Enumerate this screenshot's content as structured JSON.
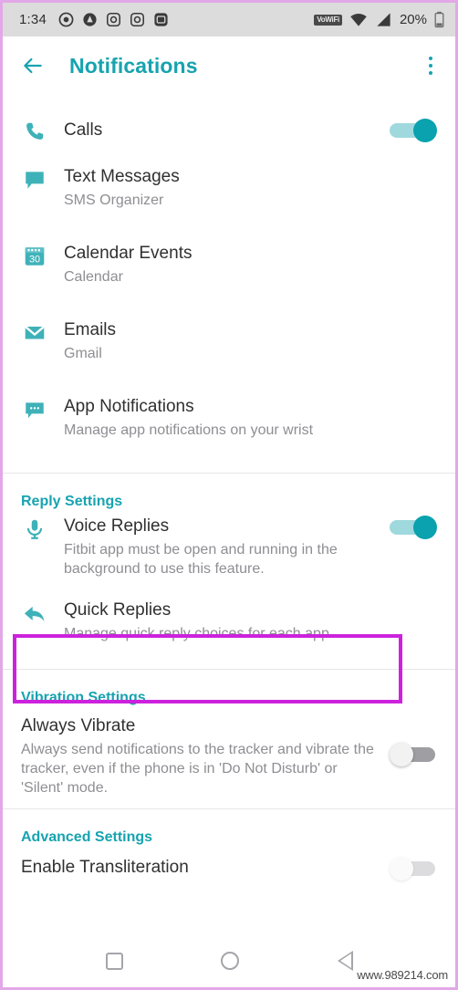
{
  "statusbar": {
    "time": "1:34",
    "left_icons": [
      "record-icon",
      "app-a-icon",
      "instagram-icon",
      "instagram-icon-2",
      "screenshot-icon"
    ],
    "vowifi_label": "VoWiFi",
    "wifi_icon": "wifi-icon",
    "signal_icon": "cellular-signal-icon",
    "battery_percent": "20%",
    "battery_icon": "battery-icon"
  },
  "appbar": {
    "back_icon": "back-arrow-icon",
    "title": "Notifications",
    "overflow_icon": "overflow-menu-icon"
  },
  "list": {
    "items": [
      {
        "name": "calls",
        "icon": "phone-icon",
        "title": "Calls",
        "subtitle": "",
        "toggle": "on"
      },
      {
        "name": "text-messages",
        "icon": "message-bubble-icon",
        "title": "Text Messages",
        "subtitle": "SMS Organizer",
        "toggle": "none"
      },
      {
        "name": "calendar-events",
        "icon": "calendar-icon",
        "icon_day": "30",
        "title": "Calendar Events",
        "subtitle": "Calendar",
        "toggle": "none"
      },
      {
        "name": "emails",
        "icon": "envelope-icon",
        "title": "Emails",
        "subtitle": "Gmail",
        "toggle": "none"
      },
      {
        "name": "app-notifications",
        "icon": "app-notification-bubble-icon",
        "title": "App Notifications",
        "subtitle": "Manage app notifications on your wrist",
        "toggle": "none"
      }
    ]
  },
  "reply_settings": {
    "header": "Reply Settings",
    "voice_replies": {
      "icon": "microphone-icon",
      "title": "Voice Replies",
      "subtitle": "Fitbit app must be open and running in the background to use this feature.",
      "toggle": "on"
    },
    "quick_replies": {
      "icon": "reply-arrow-icon",
      "title": "Quick Replies",
      "subtitle": "Manage quick reply choices for each app.",
      "toggle": "none",
      "highlighted": true
    }
  },
  "vibration_settings": {
    "header": "Vibration Settings",
    "always_vibrate": {
      "title": "Always Vibrate",
      "subtitle": "Always send notifications to the tracker and vibrate the tracker, even if the phone is in 'Do Not Disturb' or 'Silent' mode.",
      "toggle": "off"
    }
  },
  "advanced_settings": {
    "header": "Advanced Settings",
    "enable_transliteration": {
      "title": "Enable Transliteration",
      "toggle": "off"
    }
  },
  "navbar": {
    "recents_icon": "recents-square-icon",
    "home_icon": "home-circle-icon",
    "back_icon": "back-triangle-icon"
  },
  "watermark": "www.989214.com",
  "colors": {
    "accent_teal": "#17a3b0",
    "icon_teal": "#3eb2b8",
    "toggle_on": "#09a2ae",
    "highlight_magenta": "#cc22dd",
    "title_text": "#303030",
    "subtitle_text": "#8e8e93",
    "statusbar_bg": "#dcdcdc"
  }
}
